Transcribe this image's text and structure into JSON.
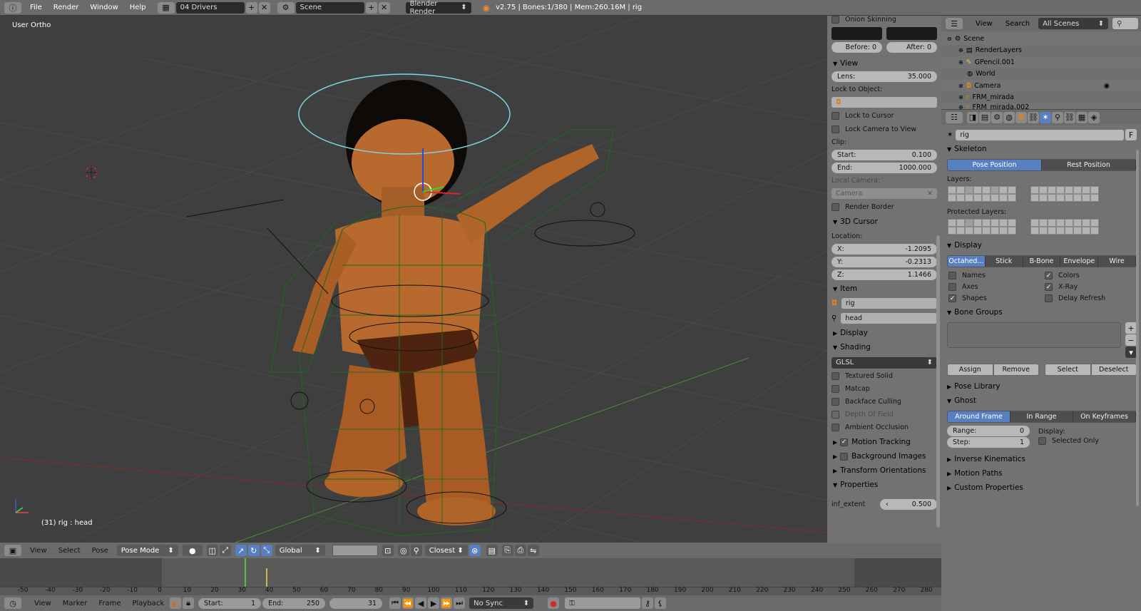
{
  "topbar": {
    "menus": [
      "File",
      "Render",
      "Window",
      "Help"
    ],
    "layout": "04 Drivers",
    "scene": "Scene",
    "engine": "Blender Render",
    "status": "v2.75 | Bones:1/380 | Mem:260.16M | rig"
  },
  "viewport": {
    "label": "User Ortho",
    "info": "(31) rig : head"
  },
  "npanel": {
    "top": {
      "section": "Onion Skinning",
      "before": "Before: 0",
      "after": "After: 0"
    },
    "view": {
      "title": "View",
      "lens_label": "Lens:",
      "lens": "35.000",
      "lock_object": "Lock to Object:",
      "lock_cursor": "Lock to Cursor",
      "lock_camera": "Lock Camera to View",
      "clip": "Clip:",
      "start_label": "Start:",
      "start": "0.100",
      "end_label": "End:",
      "end": "1000.000",
      "local_camera": "Local Camera:",
      "camera": "Camera",
      "render_border": "Render Border"
    },
    "cursor": {
      "title": "3D Cursor",
      "location": "Location:",
      "x_label": "X:",
      "x": "-1.2095",
      "y_label": "Y:",
      "y": "-0.2313",
      "z_label": "Z:",
      "z": "1.1466"
    },
    "item": {
      "title": "Item",
      "object": "rig",
      "bone": "head"
    },
    "display": "Display",
    "shading": {
      "title": "Shading",
      "mode": "GLSL",
      "textured_solid": "Textured Solid",
      "matcap": "Matcap",
      "backface": "Backface Culling",
      "dof": "Depth Of Field",
      "ao": "Ambient Occlusion"
    },
    "collapsed": [
      "Motion Tracking",
      "Background Images",
      "Transform Orientations"
    ],
    "properties": {
      "title": "Properties",
      "prop_name": "inf_extent",
      "prop_value": "0.500"
    }
  },
  "header3d": {
    "menus": [
      "View",
      "Select",
      "Pose"
    ],
    "mode": "Pose Mode",
    "orientation": "Global",
    "snap": "Closest"
  },
  "timeline": {
    "ticks": [
      "-50",
      "-40",
      "-30",
      "-20",
      "-10",
      "0",
      "10",
      "20",
      "30",
      "40",
      "50",
      "60",
      "70",
      "80",
      "90",
      "100",
      "110",
      "120",
      "130",
      "140",
      "150",
      "160",
      "170",
      "180",
      "190",
      "200",
      "210",
      "220",
      "230",
      "240",
      "250",
      "260",
      "270",
      "280"
    ],
    "current_frame": 31,
    "keyframe": 37
  },
  "tbottom": {
    "menus": [
      "View",
      "Marker",
      "Frame",
      "Playback"
    ],
    "start_label": "Start:",
    "start": "1",
    "end_label": "End:",
    "end": "250",
    "current": "31",
    "sync": "No Sync"
  },
  "outliner": {
    "menus": [
      "View",
      "Search"
    ],
    "filter": "All Scenes",
    "items": [
      "Scene",
      "RenderLayers",
      "GPencil.001",
      "World",
      "Camera",
      "FRM_mirada",
      "FRM_mirada.002"
    ]
  },
  "props": {
    "object": "rig",
    "skeleton": {
      "title": "Skeleton",
      "pose": "Pose Position",
      "rest": "Rest Position",
      "layers": "Layers:",
      "protected": "Protected Layers:"
    },
    "display": {
      "title": "Display",
      "modes": [
        "Octahed...",
        "Stick",
        "B-Bone",
        "Envelope",
        "Wire"
      ],
      "names": "Names",
      "axes": "Axes",
      "shapes": "Shapes",
      "colors": "Colors",
      "xray": "X-Ray",
      "delay": "Delay Refresh"
    },
    "bone_groups": {
      "title": "Bone Groups",
      "assign": "Assign",
      "remove": "Remove",
      "select": "Select",
      "deselect": "Deselect"
    },
    "pose_library": "Pose Library",
    "ghost": {
      "title": "Ghost",
      "modes": [
        "Around Frame",
        "In Range",
        "On Keyframes"
      ],
      "range_label": "Range:",
      "range": "0",
      "step_label": "Step:",
      "step": "1",
      "display": "Display:",
      "selected_only": "Selected Only"
    },
    "collapsed": [
      "Inverse Kinematics",
      "Motion Paths",
      "Custom Properties"
    ]
  },
  "colors": {
    "accent": "#5680c2",
    "header": "#6b6b6b",
    "panel": "#727272",
    "viewport": "#3f3f3f",
    "skin": "#b86a2e",
    "wire": "#1e6b1e"
  }
}
